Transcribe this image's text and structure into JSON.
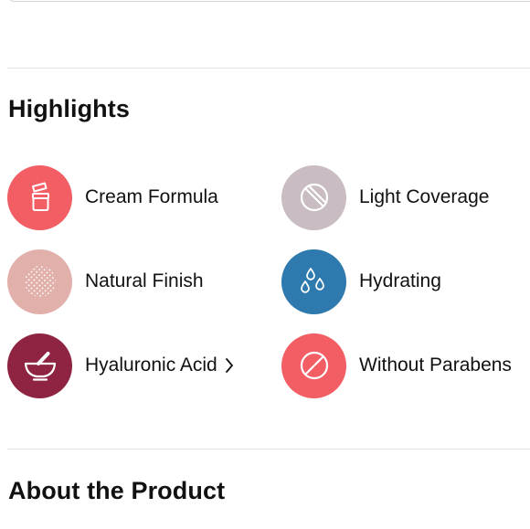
{
  "sections": {
    "highlights_title": "Highlights",
    "about_title": "About the Product"
  },
  "highlights": [
    {
      "label": "Cream Formula",
      "icon": "cream-jar-icon",
      "color": "#F25E63"
    },
    {
      "label": "Light Coverage",
      "icon": "light-coverage-icon",
      "color": "#C9BCC2"
    },
    {
      "label": "Natural Finish",
      "icon": "natural-finish-icon",
      "color": "#E2B0AB"
    },
    {
      "label": "Hydrating",
      "icon": "water-drops-icon",
      "color": "#2E79AD"
    },
    {
      "label": "Hyaluronic Acid",
      "icon": "mortar-pestle-icon",
      "color": "#8E2441",
      "chevron_icon": "chevron-right-icon"
    },
    {
      "label": "Without Parabens",
      "icon": "no-symbol-icon",
      "color": "#F25E63"
    }
  ]
}
